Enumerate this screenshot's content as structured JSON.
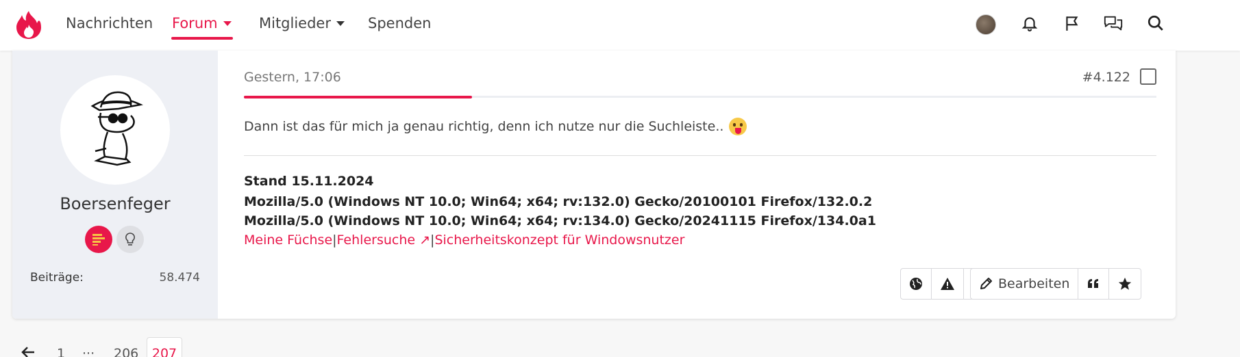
{
  "nav": {
    "items": [
      {
        "label": "Nachrichten"
      },
      {
        "label": "Forum"
      },
      {
        "label": "Mitglieder"
      },
      {
        "label": "Spenden"
      }
    ],
    "icons": [
      "user-avatar",
      "bell-icon",
      "flag-icon",
      "chat-icon",
      "search-icon"
    ]
  },
  "post": {
    "user": {
      "name": "Boersenfeger",
      "stat_label": "Beiträge:",
      "stat_value": "58.474"
    },
    "date": "Gestern, 17:06",
    "number": "#4.122",
    "read_progress_percent": 25,
    "text": "Dann ist das für mich ja genau richtig, denn ich nutze nur die Suchleiste..",
    "signature": {
      "lines": [
        "Stand 15.11.2024",
        "Mozilla/5.0 (Windows NT 10.0; Win64; x64; rv:132.0) Gecko/20100101 Firefox/132.0.2",
        "Mozilla/5.0 (Windows NT 10.0; Win64; x64; rv:134.0) Gecko/20241115 Firefox/134.0a1"
      ],
      "links": [
        "Meine Füchse",
        "Fehlersuche ↗",
        "Sicherheitskonzept für Windowsnutzer"
      ],
      "separator": "|"
    },
    "actions": {
      "edit_label": "Bearbeiten"
    }
  },
  "pagination": {
    "prev_icon": "arrow-left-icon",
    "pages": [
      "1",
      "···",
      "206",
      "207"
    ],
    "current": "207"
  },
  "colors": {
    "accent": "#e8174a"
  }
}
